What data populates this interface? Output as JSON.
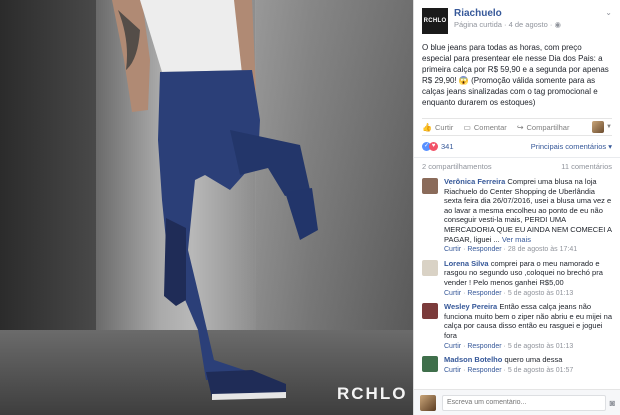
{
  "photo": {
    "brand": "RCHLO"
  },
  "post": {
    "page_name": "Riachuelo",
    "logo_text": "RCHLO",
    "meta": "Página curtida · 4 de agosto ·",
    "text": "O blue jeans para todas as horas, com preço especial para presentear ele nesse Dia dos Pais: a primeira calça por R$ 59,90 e a segunda por apenas R$ 29,90! 😱 (Promoção válida somente para as calças jeans sinalizadas com o tag promocional e enquanto durarem os estoques)",
    "actions": {
      "like": "Curtir",
      "comment": "Comentar",
      "share": "Compartilhar"
    },
    "reaction_count": "341",
    "sort_label": "Principais comentários ▾",
    "shares": "2 compartilhamentos",
    "comment_count": "11 comentários"
  },
  "comments": [
    {
      "name": "Verônica Ferreira",
      "text": "Comprei uma blusa na loja Riachuelo do Center Shopping de Uberlândia sexta feira dia 26/07/2016, usei a blusa uma vez e ao lavar a mesma encolheu ao ponto de eu não conseguir vesti-la mais, PERDI UMA MERCADORIA QUE EU AINDA NEM COMECEI A PAGAR, liguei ...",
      "more": "Ver mais",
      "meta_like": "Curtir",
      "meta_reply": "Responder",
      "time": "28 de agosto às 17:41",
      "color": "#8a6b5a"
    },
    {
      "name": "Lorena Silva",
      "text": "comprei para o meu namorado e rasgou no segundo uso ,coloquei no brechó pra vender ! Pelo menos ganhei R$5,00",
      "more": "",
      "meta_like": "Curtir",
      "meta_reply": "Responder",
      "time": "5 de agosto às 01:13",
      "color": "#d9d2c5"
    },
    {
      "name": "Wesley Pereira",
      "text": "Então essa calça jeans não funciona muito bem o ziper não abriu e eu mijei na calça por causa disso então eu rasguei e joguei fora",
      "more": "",
      "meta_like": "Curtir",
      "meta_reply": "Responder",
      "time": "5 de agosto às 01:13",
      "color": "#7b3b3b"
    },
    {
      "name": "Madson Botelho",
      "text": "quero uma dessa",
      "more": "",
      "meta_like": "Curtir",
      "meta_reply": "Responder",
      "time": "5 de agosto às 01:57",
      "color": "#3f6f4b"
    }
  ],
  "compose": {
    "placeholder": "Escreva um comentário..."
  }
}
